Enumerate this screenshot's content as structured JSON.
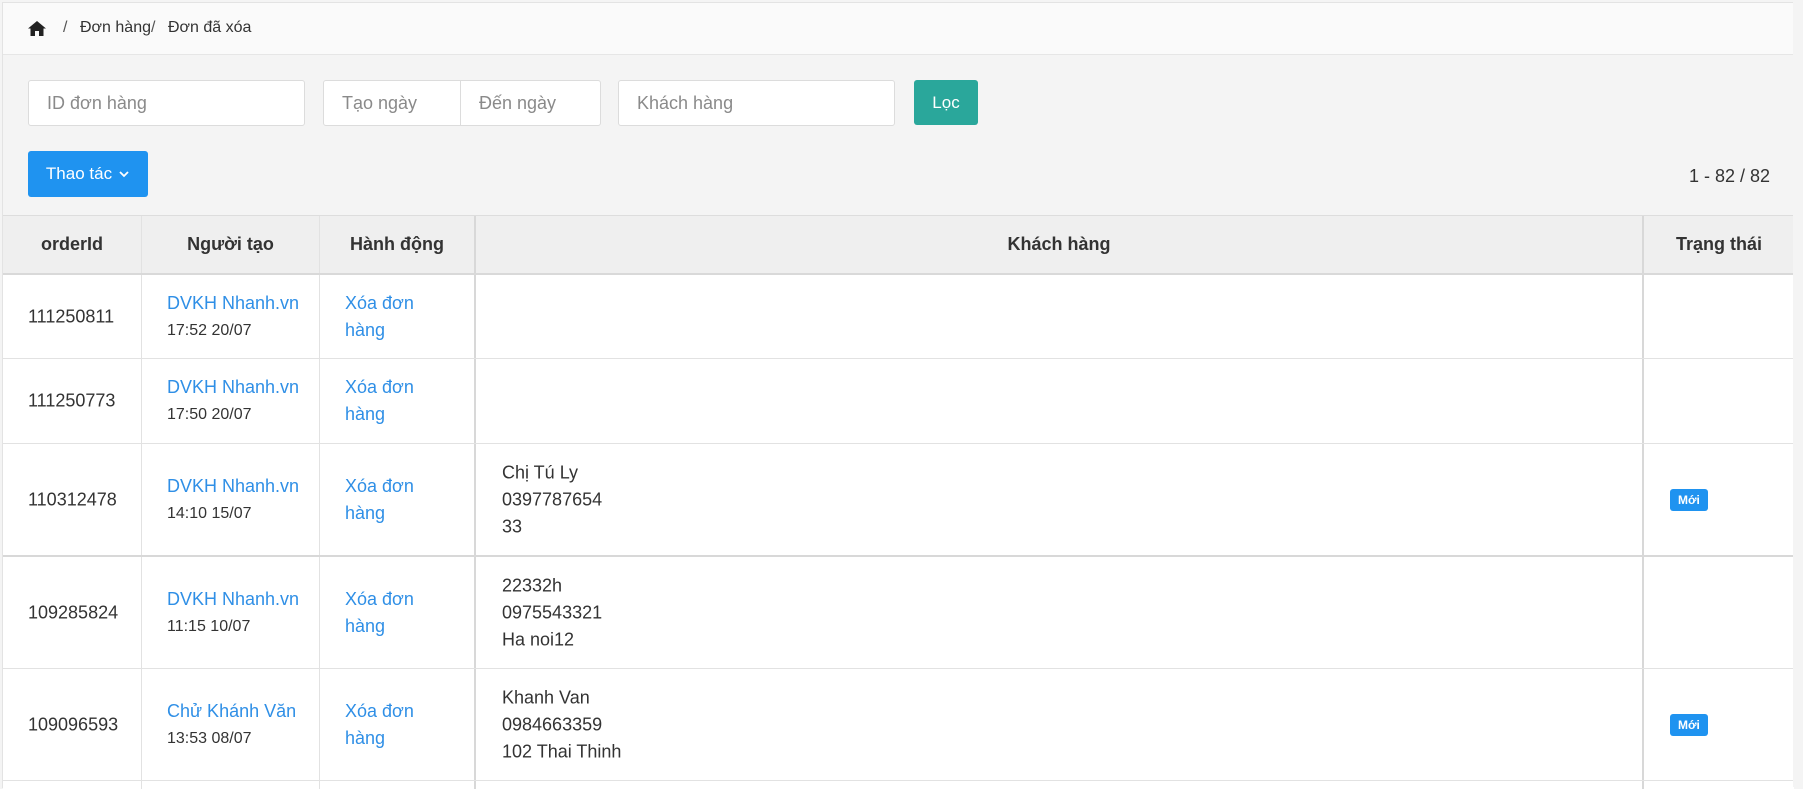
{
  "breadcrumb": {
    "home_icon": "home-icon",
    "items": [
      "Đơn hàng",
      "Đơn đã xóa"
    ],
    "separator": "/"
  },
  "filters": {
    "order_id_placeholder": "ID đơn hàng",
    "date_from_placeholder": "Tạo ngày",
    "date_to_placeholder": "Đến ngày",
    "customer_placeholder": "Khách hàng",
    "filter_button": "Lọc"
  },
  "toolbar": {
    "actions_button": "Thao tác",
    "pager": "1 - 82 / 82"
  },
  "table": {
    "headers": [
      "orderId",
      "Người tạo",
      "Hành động",
      "Khách hàng",
      "Trạng thái"
    ],
    "rows": [
      {
        "order_id": "111250811",
        "creator": "DVKH Nhanh.vn",
        "time": "17:52 20/07",
        "action": "Xóa đơn hàng",
        "customer": [],
        "status": ""
      },
      {
        "order_id": "111250773",
        "creator": "DVKH Nhanh.vn",
        "time": "17:50 20/07",
        "action": "Xóa đơn hàng",
        "customer": [],
        "status": ""
      },
      {
        "order_id": "110312478",
        "creator": "DVKH Nhanh.vn",
        "time": "14:10 15/07",
        "action": "Xóa đơn hàng",
        "customer": [
          "Chị Tú Ly",
          "0397787654",
          "33"
        ],
        "status": "Mới"
      },
      {
        "order_id": "109285824",
        "creator": "DVKH Nhanh.vn",
        "time": "11:15 10/07",
        "action": "Xóa đơn hàng",
        "customer": [
          "22332h",
          "0975543321",
          "Ha noi12"
        ],
        "status": ""
      },
      {
        "order_id": "109096593",
        "creator": "Chử Khánh Văn",
        "time": "13:53 08/07",
        "action": "Xóa đơn hàng",
        "customer": [
          "Khanh Van",
          "0984663359",
          "102 Thai Thinh"
        ],
        "status": "Mới"
      }
    ]
  },
  "colors": {
    "link": "#2f8fe6",
    "primary_button": "#1f93f0",
    "filter_button": "#2aa79b",
    "badge": "#1f93f0"
  }
}
